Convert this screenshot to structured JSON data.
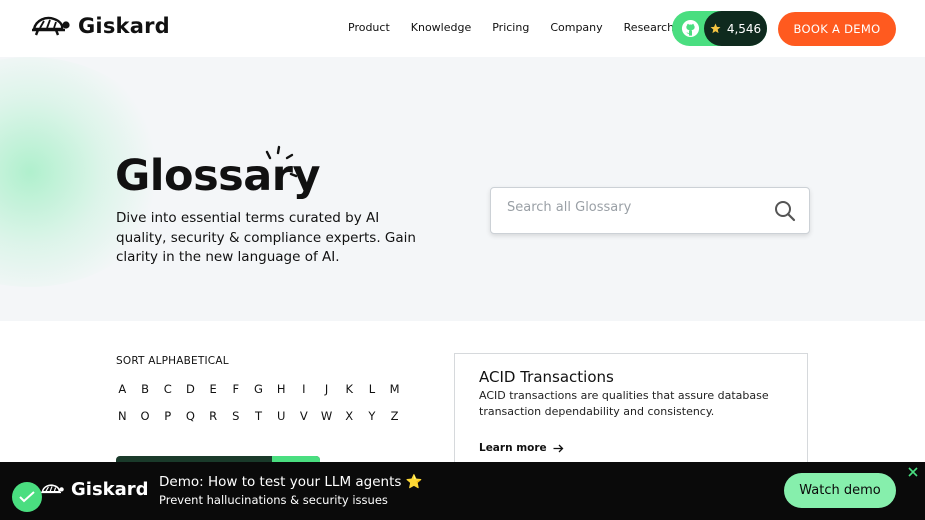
{
  "nav": {
    "logo_text": "Giskard",
    "links": [
      "Product",
      "Knowledge",
      "Pricing",
      "Company",
      "Research"
    ],
    "github_stars": "4,546",
    "demo_button": "BOOK A DEMO"
  },
  "hero": {
    "title": "Glossary",
    "description": "Dive into essential terms curated by AI quality, security & compliance experts. Gain clarity in the new language of AI.",
    "search_placeholder": "Search all Glossary"
  },
  "sort": {
    "label": "SORT ALPHABETICAL",
    "letters": [
      "A",
      "B",
      "C",
      "D",
      "E",
      "F",
      "G",
      "H",
      "I",
      "J",
      "K",
      "L",
      "M",
      "N",
      "O",
      "P",
      "Q",
      "R",
      "S",
      "T",
      "U",
      "V",
      "W",
      "X",
      "Y",
      "Z"
    ]
  },
  "card": {
    "title": "ACID Transactions",
    "description": "ACID transactions are qualities that assure database transaction dependability and consistency.",
    "link": "Learn more"
  },
  "banner": {
    "logo_text": "Giskard",
    "title": "Demo: How to test your LLM agents ⭐",
    "subtitle": "Prevent hallucinations & security issues",
    "button": "Watch demo"
  },
  "colors": {
    "accent_orange": "#ff5a1f",
    "accent_green": "#4ade80",
    "dark_green": "#0f2a1e"
  }
}
